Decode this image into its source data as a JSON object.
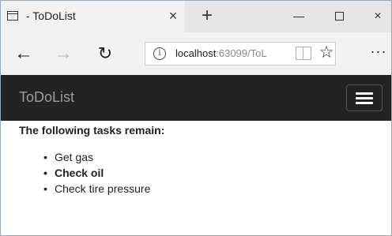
{
  "browser": {
    "tab": {
      "title": "- ToDoList",
      "close_glyph": "×"
    },
    "new_tab_glyph": "+",
    "window_controls": {
      "close_glyph": "×"
    },
    "nav": {
      "back_glyph": "←",
      "forward_glyph": "→",
      "refresh_glyph": "↻"
    },
    "address": {
      "info_glyph": "i",
      "host": "localhost",
      "rest": ":63099/ToL",
      "favorite_glyph": "☆"
    },
    "more_glyph": "···",
    "icons": [
      "tab-page-icon",
      "close-icon",
      "plus-icon",
      "minimize-icon",
      "maximize-icon",
      "back-arrow-icon",
      "forward-arrow-icon",
      "refresh-icon",
      "info-icon",
      "reading-view-icon",
      "star-icon",
      "more-icon",
      "hamburger-menu-icon"
    ]
  },
  "app": {
    "brand": "ToDoList",
    "navbar_color": "#222222",
    "heading": "The following tasks remain:",
    "tasks": [
      {
        "label": "Get gas",
        "important": false
      },
      {
        "label": "Check oil",
        "important": true
      },
      {
        "label": "Check tire pressure",
        "important": false
      }
    ],
    "bullet": "•"
  }
}
